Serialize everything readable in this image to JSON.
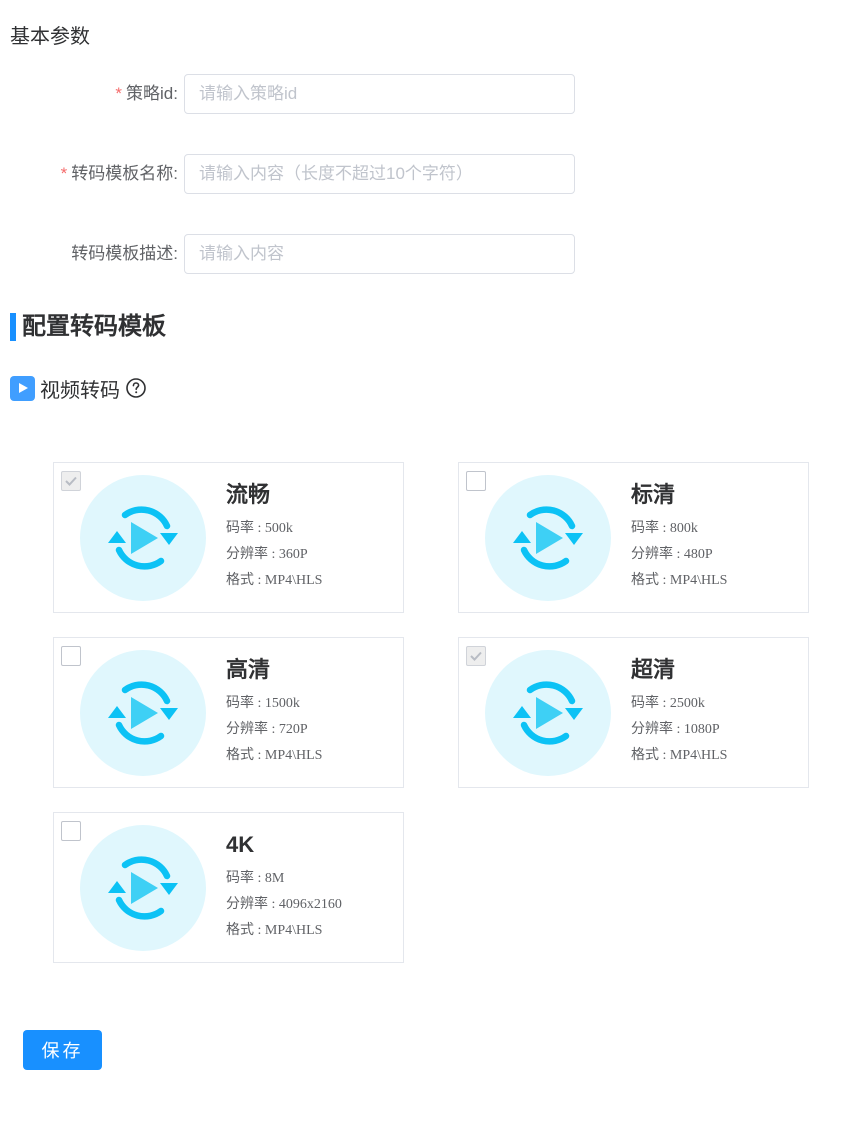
{
  "basic": {
    "title": "基本参数"
  },
  "form": {
    "strategy_id": {
      "required": true,
      "label": "策略id:",
      "placeholder": "请输入策略id",
      "value": ""
    },
    "template_name": {
      "required": true,
      "label": "转码模板名称:",
      "placeholder": "请输入内容（长度不超过10个字符）",
      "value": ""
    },
    "template_desc": {
      "required": false,
      "label": "转码模板描述:",
      "placeholder": "请输入内容",
      "value": ""
    },
    "required_mark": "*"
  },
  "config": {
    "title": "配置转码模板"
  },
  "video": {
    "title": "视频转码",
    "icon": "play-square-icon",
    "help_icon": "question-circle-icon"
  },
  "templates": [
    {
      "name": "流畅",
      "bitrate": "码率 : 500k",
      "resolution": "分辨率 : 360P",
      "format": "格式 : MP4\\HLS",
      "checked": true
    },
    {
      "name": "标清",
      "bitrate": "码率 : 800k",
      "resolution": "分辨率 : 480P",
      "format": "格式 : MP4\\HLS",
      "checked": false
    },
    {
      "name": "高清",
      "bitrate": "码率 : 1500k",
      "resolution": "分辨率 : 720P",
      "format": "格式 : MP4\\HLS",
      "checked": false
    },
    {
      "name": "超清",
      "bitrate": "码率 : 2500k",
      "resolution": "分辨率 : 1080P",
      "format": "格式 : MP4\\HLS",
      "checked": true
    },
    {
      "name": "4K",
      "bitrate": "码率 : 8M",
      "resolution": "分辨率 : 4096x2160",
      "format": "格式 : MP4\\HLS",
      "checked": false
    }
  ],
  "actions": {
    "save_label": "保存"
  },
  "colors": {
    "primary": "#1890ff",
    "required": "#f56c6c",
    "icon_bg": "#e0f7fd",
    "icon_fg": "#0cc2f5"
  }
}
